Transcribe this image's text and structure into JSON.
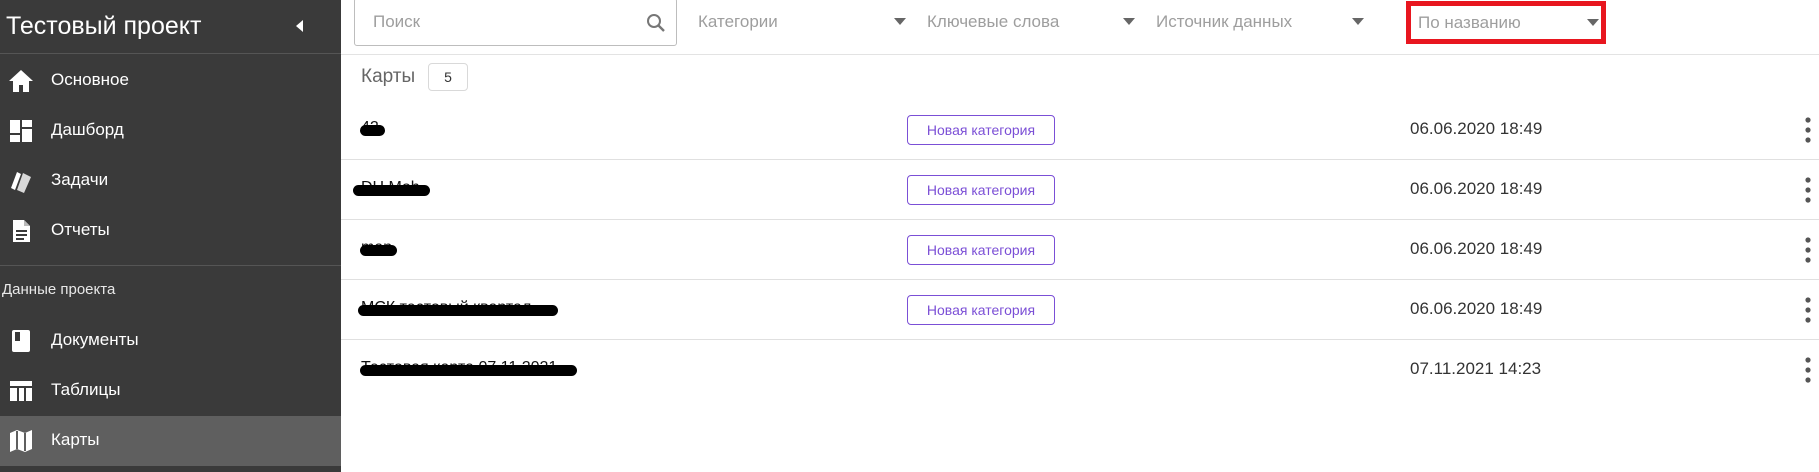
{
  "sidebar": {
    "title": "Тестовый проект",
    "section_label": "Данные проекта",
    "items": [
      {
        "label": "Основное",
        "icon": "home-icon"
      },
      {
        "label": "Дашборд",
        "icon": "dashboard-icon"
      },
      {
        "label": "Задачи",
        "icon": "tasks-icon"
      },
      {
        "label": "Отчеты",
        "icon": "report-icon"
      },
      {
        "label": "Документы",
        "icon": "book-icon"
      },
      {
        "label": "Таблицы",
        "icon": "table-icon"
      },
      {
        "label": "Карты",
        "icon": "map-icon",
        "active": true
      }
    ]
  },
  "toolbar": {
    "search_placeholder": "Поиск",
    "filter_categories": "Категории",
    "filter_keywords": "Ключевые слова",
    "filter_source": "Источник данных",
    "sort_label": "По названию"
  },
  "main": {
    "section_title": "Карты",
    "count": "5",
    "rows": [
      {
        "name": "42",
        "category": "Новая категория",
        "date": "06.06.2020 18:49"
      },
      {
        "name": "DH Moh",
        "category": "Новая категория",
        "date": "06.06.2020 18:49"
      },
      {
        "name": "map",
        "category": "Новая категория",
        "date": "06.06.2020 18:49"
      },
      {
        "name": "МСК тестовый квартал",
        "category": "Новая категория",
        "date": "06.06.2020 18:49"
      },
      {
        "name": "Тестовая карта 07.11.2021",
        "category": "",
        "date": "07.11.2021 14:23"
      }
    ]
  },
  "colors": {
    "sidebar_bg": "#3a3a3a",
    "sidebar_active": "#5f5f5f",
    "tag_accent": "#7b4fd6",
    "highlight_border": "#e8161f"
  }
}
